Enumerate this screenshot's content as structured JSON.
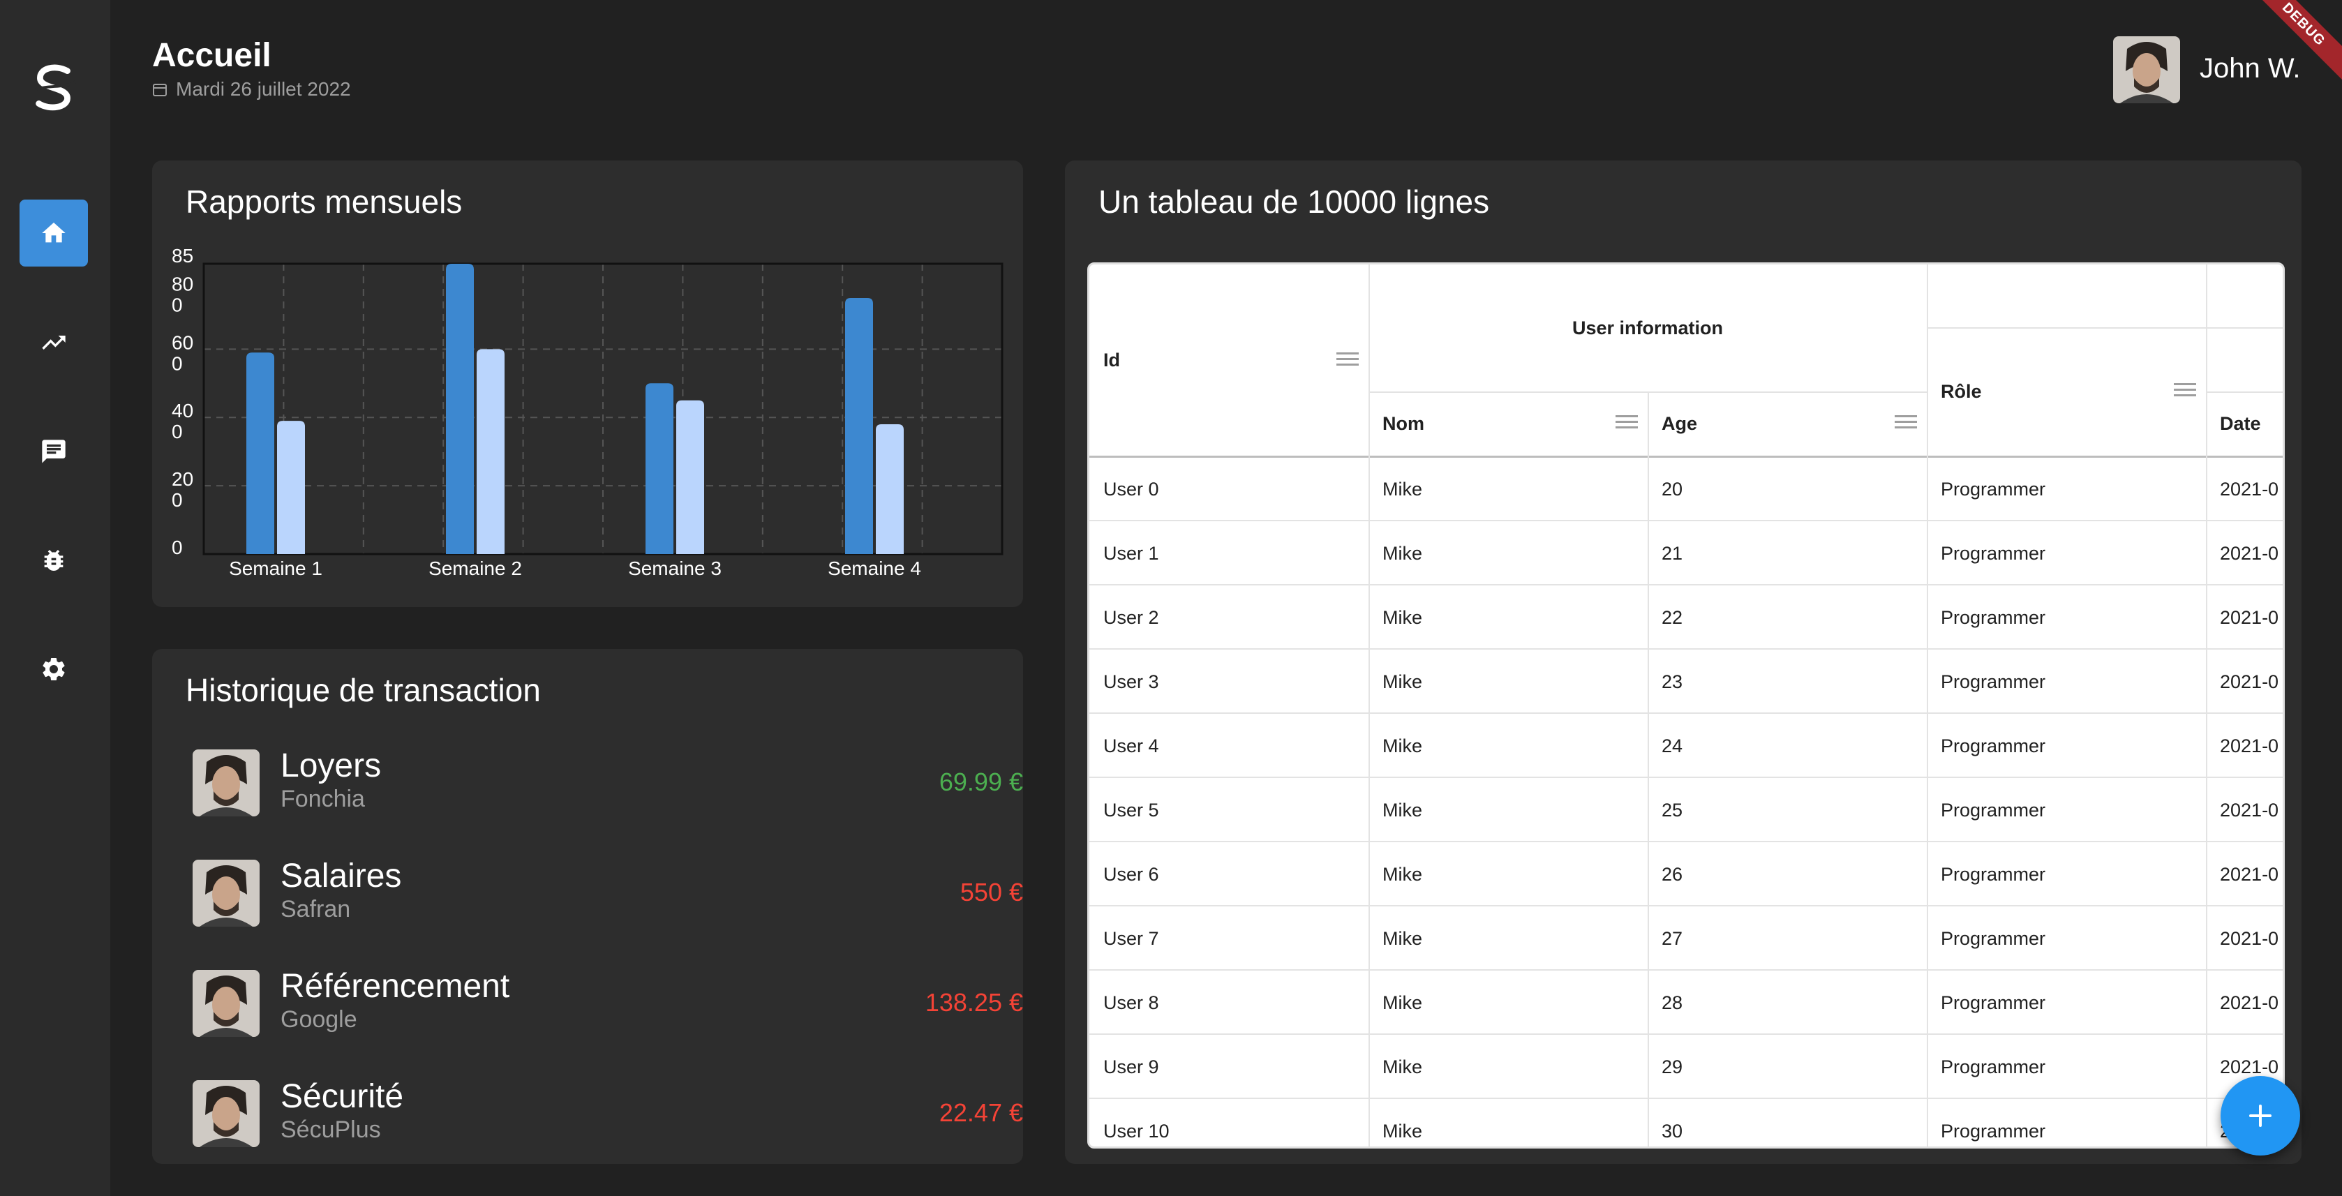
{
  "header": {
    "title": "Accueil",
    "date": "Mardi 26 juillet 2022",
    "user_name": "John W.",
    "debug_label": "DEBUG"
  },
  "sidebar": {
    "items": [
      {
        "icon": "home-icon",
        "active": true
      },
      {
        "icon": "trending-up-icon",
        "active": false
      },
      {
        "icon": "chat-icon",
        "active": false
      },
      {
        "icon": "bug-icon",
        "active": false
      },
      {
        "icon": "settings-icon",
        "active": false
      }
    ]
  },
  "monthly_report": {
    "title": "Rapports mensuels",
    "y_tick_labels": [
      "0",
      "20\n0",
      "40\n0",
      "60\n0",
      "80\n0",
      "85"
    ]
  },
  "chart_data": {
    "type": "bar",
    "title": "Rapports mensuels",
    "categories": [
      "Semaine 1",
      "Semaine 2",
      "Semaine 3",
      "Semaine 4"
    ],
    "ylim": [
      0,
      850
    ],
    "yticks": [
      0,
      200,
      400,
      600,
      800,
      850
    ],
    "series": [
      {
        "values": [
          590,
          850,
          500,
          750
        ],
        "color": "#3d88d0"
      },
      {
        "values": [
          390,
          600,
          450,
          380
        ],
        "color": "#bad5fd"
      }
    ],
    "grid": true
  },
  "transactions": {
    "title": "Historique de transaction",
    "items": [
      {
        "title": "Loyers",
        "subtitle": "Fonchia",
        "amount": "69.99 €",
        "color": "#4caf50"
      },
      {
        "title": "Salaires",
        "subtitle": "Safran",
        "amount": "550 €",
        "color": "#f44336"
      },
      {
        "title": "Référencement",
        "subtitle": "Google",
        "amount": "138.25 €",
        "color": "#f44336"
      },
      {
        "title": "Sécurité",
        "subtitle": "SécuPlus",
        "amount": "22.47 €",
        "color": "#f44336"
      }
    ]
  },
  "table": {
    "title": "Un tableau de 10000 lignes",
    "headers": {
      "id": "Id",
      "group": "User information",
      "name": "Nom",
      "age": "Age",
      "role": "Rôle",
      "date": "Date"
    },
    "rows": [
      {
        "id": "User 0",
        "name": "Mike",
        "age": "20",
        "role": "Programmer",
        "date": "2021-0"
      },
      {
        "id": "User 1",
        "name": "Mike",
        "age": "21",
        "role": "Programmer",
        "date": "2021-0"
      },
      {
        "id": "User 2",
        "name": "Mike",
        "age": "22",
        "role": "Programmer",
        "date": "2021-0"
      },
      {
        "id": "User 3",
        "name": "Mike",
        "age": "23",
        "role": "Programmer",
        "date": "2021-0"
      },
      {
        "id": "User 4",
        "name": "Mike",
        "age": "24",
        "role": "Programmer",
        "date": "2021-0"
      },
      {
        "id": "User 5",
        "name": "Mike",
        "age": "25",
        "role": "Programmer",
        "date": "2021-0"
      },
      {
        "id": "User 6",
        "name": "Mike",
        "age": "26",
        "role": "Programmer",
        "date": "2021-0"
      },
      {
        "id": "User 7",
        "name": "Mike",
        "age": "27",
        "role": "Programmer",
        "date": "2021-0"
      },
      {
        "id": "User 8",
        "name": "Mike",
        "age": "28",
        "role": "Programmer",
        "date": "2021-0"
      },
      {
        "id": "User 9",
        "name": "Mike",
        "age": "29",
        "role": "Programmer",
        "date": "2021-0"
      },
      {
        "id": "User 10",
        "name": "Mike",
        "age": "30",
        "role": "Programmer",
        "date": "2"
      }
    ]
  },
  "fab": {
    "icon": "plus-icon"
  }
}
